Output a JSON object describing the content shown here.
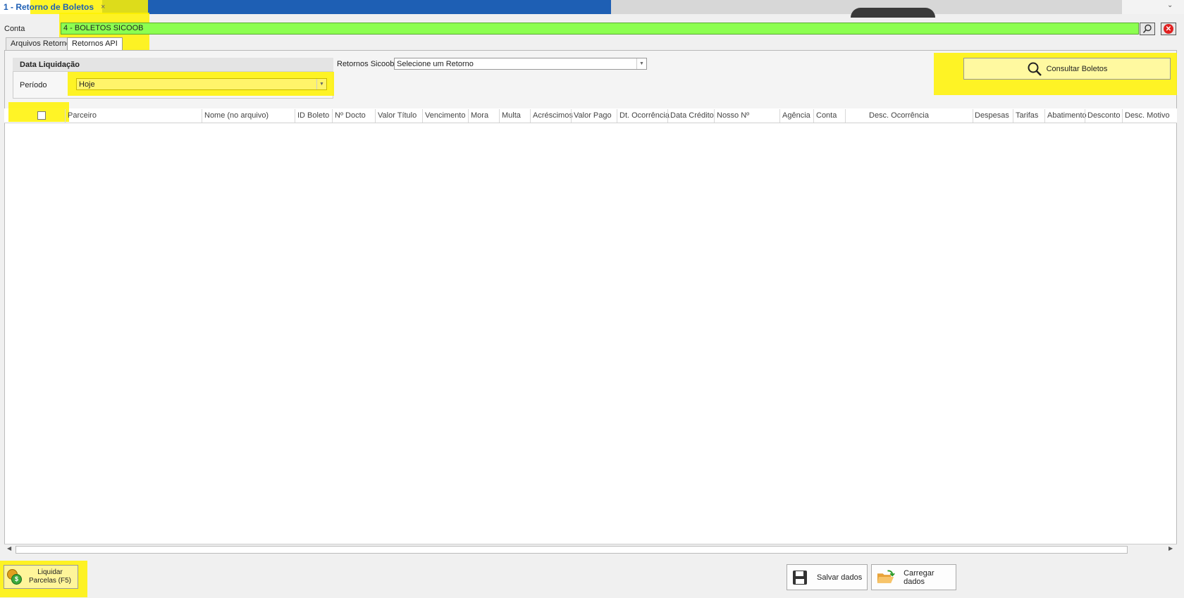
{
  "document_tab": {
    "title": "1 - Retorno de Boletos",
    "close": "×"
  },
  "window_menu_glyph": "⌄",
  "conta": {
    "label": "Conta",
    "value": "4 - BOLETOS SICOOB"
  },
  "tabs": [
    {
      "label": "Arquivos Retornos",
      "active": false
    },
    {
      "label": "Retornos API",
      "active": true
    }
  ],
  "filters": {
    "group_title": "Data Liquidação",
    "periodo_label": "Período",
    "periodo_value": "Hoje",
    "retornos_label": "Retornos Sicoob",
    "retornos_value": "Selecione um Retorno"
  },
  "consultar_label": "Consultar Boletos",
  "grid": {
    "columns": [
      "Parceiro",
      "Nome (no arquivo)",
      "ID Boleto",
      "Nº Docto",
      "Valor Título",
      "Vencimento",
      "Mora",
      "Multa",
      "Acréscimos",
      "Valor Pago",
      "Dt. Ocorrência",
      "Data Crédito",
      "Nosso Nº",
      "Agência",
      "Conta",
      "Desc. Ocorrência",
      "Despesas",
      "Tarifas",
      "Abatimento",
      "Desconto",
      "Desc. Motivo"
    ],
    "rows": []
  },
  "buttons": {
    "liquidar_line1": "Liquidar",
    "liquidar_line2": "Parcelas (F5)",
    "salvar": "Salvar dados",
    "carregar": "Carregar dados"
  },
  "colors": {
    "conta_bg": "#8cff50",
    "highlight": "#fff200",
    "title_blue": "#1e5fb4"
  }
}
